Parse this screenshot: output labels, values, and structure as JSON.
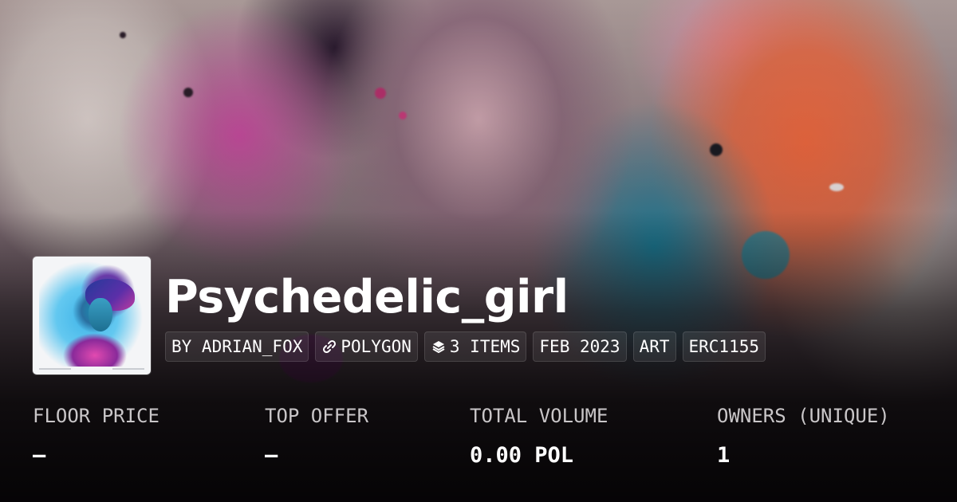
{
  "collection": {
    "title": "Psychedelic_girl",
    "badges": [
      {
        "label": "BY ADRIAN_FOX",
        "icon": null
      },
      {
        "label": "POLYGON",
        "icon": "link-chain-icon"
      },
      {
        "label": "3 ITEMS",
        "icon": "layers-icon"
      },
      {
        "label": "FEB 2023",
        "icon": null
      },
      {
        "label": "ART",
        "icon": null
      },
      {
        "label": "ERC1155",
        "icon": null
      }
    ]
  },
  "stats": [
    {
      "label": "FLOOR PRICE",
      "value": "–"
    },
    {
      "label": "TOP OFFER",
      "value": "–"
    },
    {
      "label": "TOTAL VOLUME",
      "value": "0.00 POL"
    },
    {
      "label": "OWNERS (UNIQUE)",
      "value": "1"
    }
  ],
  "colors": {
    "text": "#ffffff",
    "label": "#c9c6c8",
    "badge_bg": "rgba(255,255,255,0.08)"
  }
}
